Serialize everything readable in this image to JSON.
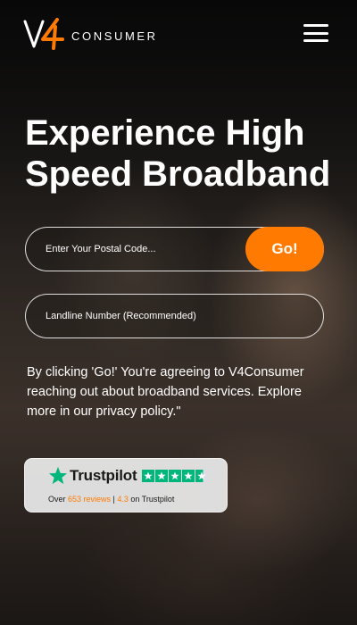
{
  "brand": {
    "logo_text": "V4",
    "word": "CONSUMER",
    "accent_color": "#ff7a00"
  },
  "header": {
    "menu_icon": "hamburger-menu-icon"
  },
  "hero": {
    "title": "Experience High Speed Broadband"
  },
  "form": {
    "postal_placeholder": "Enter Your Postal Code...",
    "postal_value": "",
    "go_label": "Go!",
    "landline_placeholder": "Landline Number (Recommended)",
    "landline_value": ""
  },
  "consent_text": "By clicking 'Go!' You're agreeing to V4Consumer reaching out about broadband services. Explore more in our privacy policy.\"",
  "trustpilot": {
    "name": "Trustpilot",
    "icon": "trustpilot-star-icon",
    "stars_rating": 4.3,
    "prefix": "Over ",
    "reviews": "653 reviews",
    "separator": " | ",
    "score": "4.3",
    "suffix": " on Trustpilot",
    "star_color": "#00b67a"
  }
}
